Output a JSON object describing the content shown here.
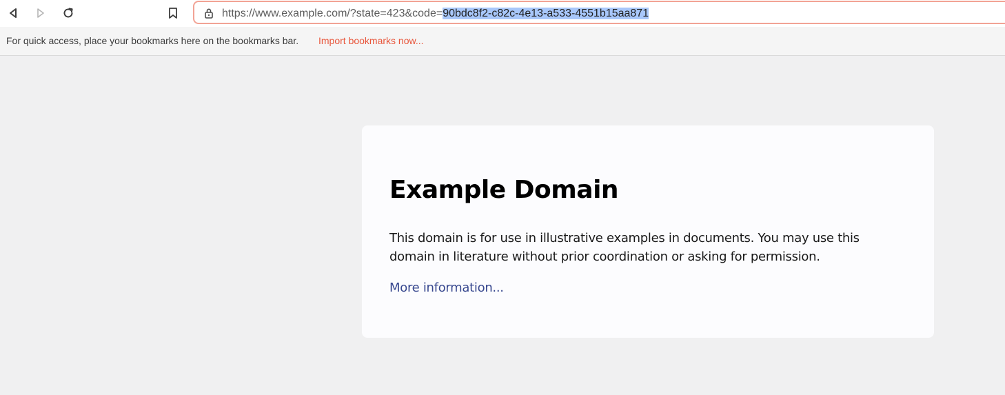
{
  "browser": {
    "back_icon": "back-arrow-icon",
    "forward_icon": "forward-arrow-icon",
    "reload_icon": "reload-icon",
    "bookmark_icon": "bookmark-icon",
    "lock_icon": "lock-icon",
    "url_prefix": "https://www.example.com/?state=423&code=",
    "url_selected": "90bdc8f2-c82c-4e13-a533-4551b15aa871"
  },
  "bookmarks_bar": {
    "hint": "For quick access, place your bookmarks here on the bookmarks bar.",
    "import_link": "Import bookmarks now..."
  },
  "page": {
    "title": "Example Domain",
    "body": "This domain is for use in illustrative examples in documents. You may use this domain in literature without prior coordination or asking for permission.",
    "link": "More information..."
  },
  "colors": {
    "omnibox_border": "#f2a395",
    "selection": "#a8c7fa",
    "import_link": "#e8553a",
    "page_link": "#38488f",
    "page_background": "#f0f0f1",
    "card_background": "#fcfcfe"
  }
}
